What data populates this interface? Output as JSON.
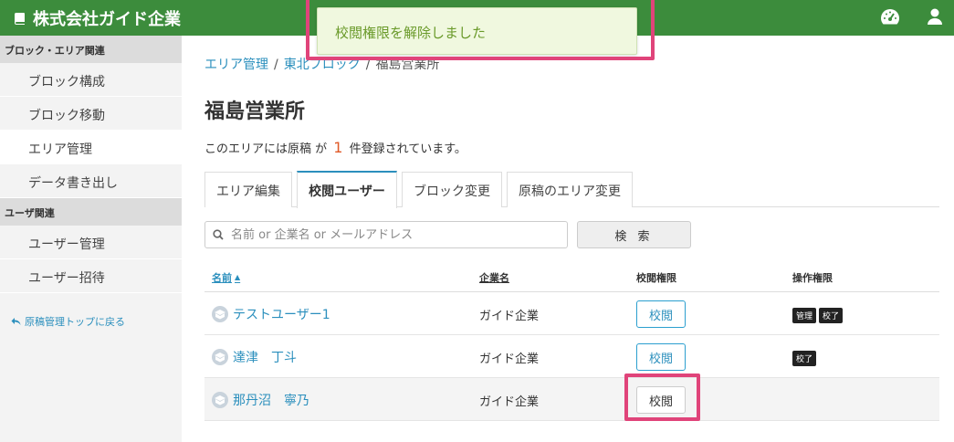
{
  "header": {
    "title": "株式会社ガイド企業",
    "icons": [
      "book-icon",
      "dashboard-icon",
      "user-icon"
    ]
  },
  "toast": {
    "message": "校閲権限を解除しました"
  },
  "sidebar": {
    "sections": [
      {
        "title": "ブロック・エリア関連",
        "items": [
          "ブロック構成",
          "ブロック移動",
          "エリア管理",
          "データ書き出し"
        ]
      },
      {
        "title": "ユーザ関連",
        "items": [
          "ユーザー管理",
          "ユーザー招待"
        ]
      }
    ],
    "back_link": "原稿管理トップに戻る"
  },
  "breadcrumb": {
    "items": [
      "エリア管理",
      "東北ブロック",
      "福島営業所"
    ],
    "separator": "/"
  },
  "page": {
    "title": "福島営業所",
    "count_prefix": "このエリアには原稿 が",
    "count_value": "1",
    "count_suffix": "件登録されています。"
  },
  "tabs": [
    "エリア編集",
    "校閲ユーザー",
    "ブロック変更",
    "原稿のエリア変更"
  ],
  "active_tab": "校閲ユーザー",
  "search": {
    "placeholder": "名前 or 企業名 or メールアドレス",
    "button_label": "検 索"
  },
  "table": {
    "headers": {
      "name": "名前",
      "company": "企業名",
      "review": "校閲権限",
      "ops": "操作権限"
    },
    "rows": [
      {
        "name": "テストユーザー1",
        "company": "ガイド企業",
        "review_label": "校閲",
        "review_on": true,
        "perms": [
          "管理",
          "校了"
        ]
      },
      {
        "name": "達津　丁斗",
        "company": "ガイド企業",
        "review_label": "校閲",
        "review_on": true,
        "perms": [
          "校了"
        ]
      },
      {
        "name": "那丹沼　寧乃",
        "company": "ガイド企業",
        "review_label": "校閲",
        "review_on": false,
        "perms": []
      }
    ]
  },
  "colors": {
    "header": "#3c8c3c",
    "link": "#2b8fbd",
    "highlight": "#e0447a",
    "toast_text": "#6a9a2a"
  }
}
